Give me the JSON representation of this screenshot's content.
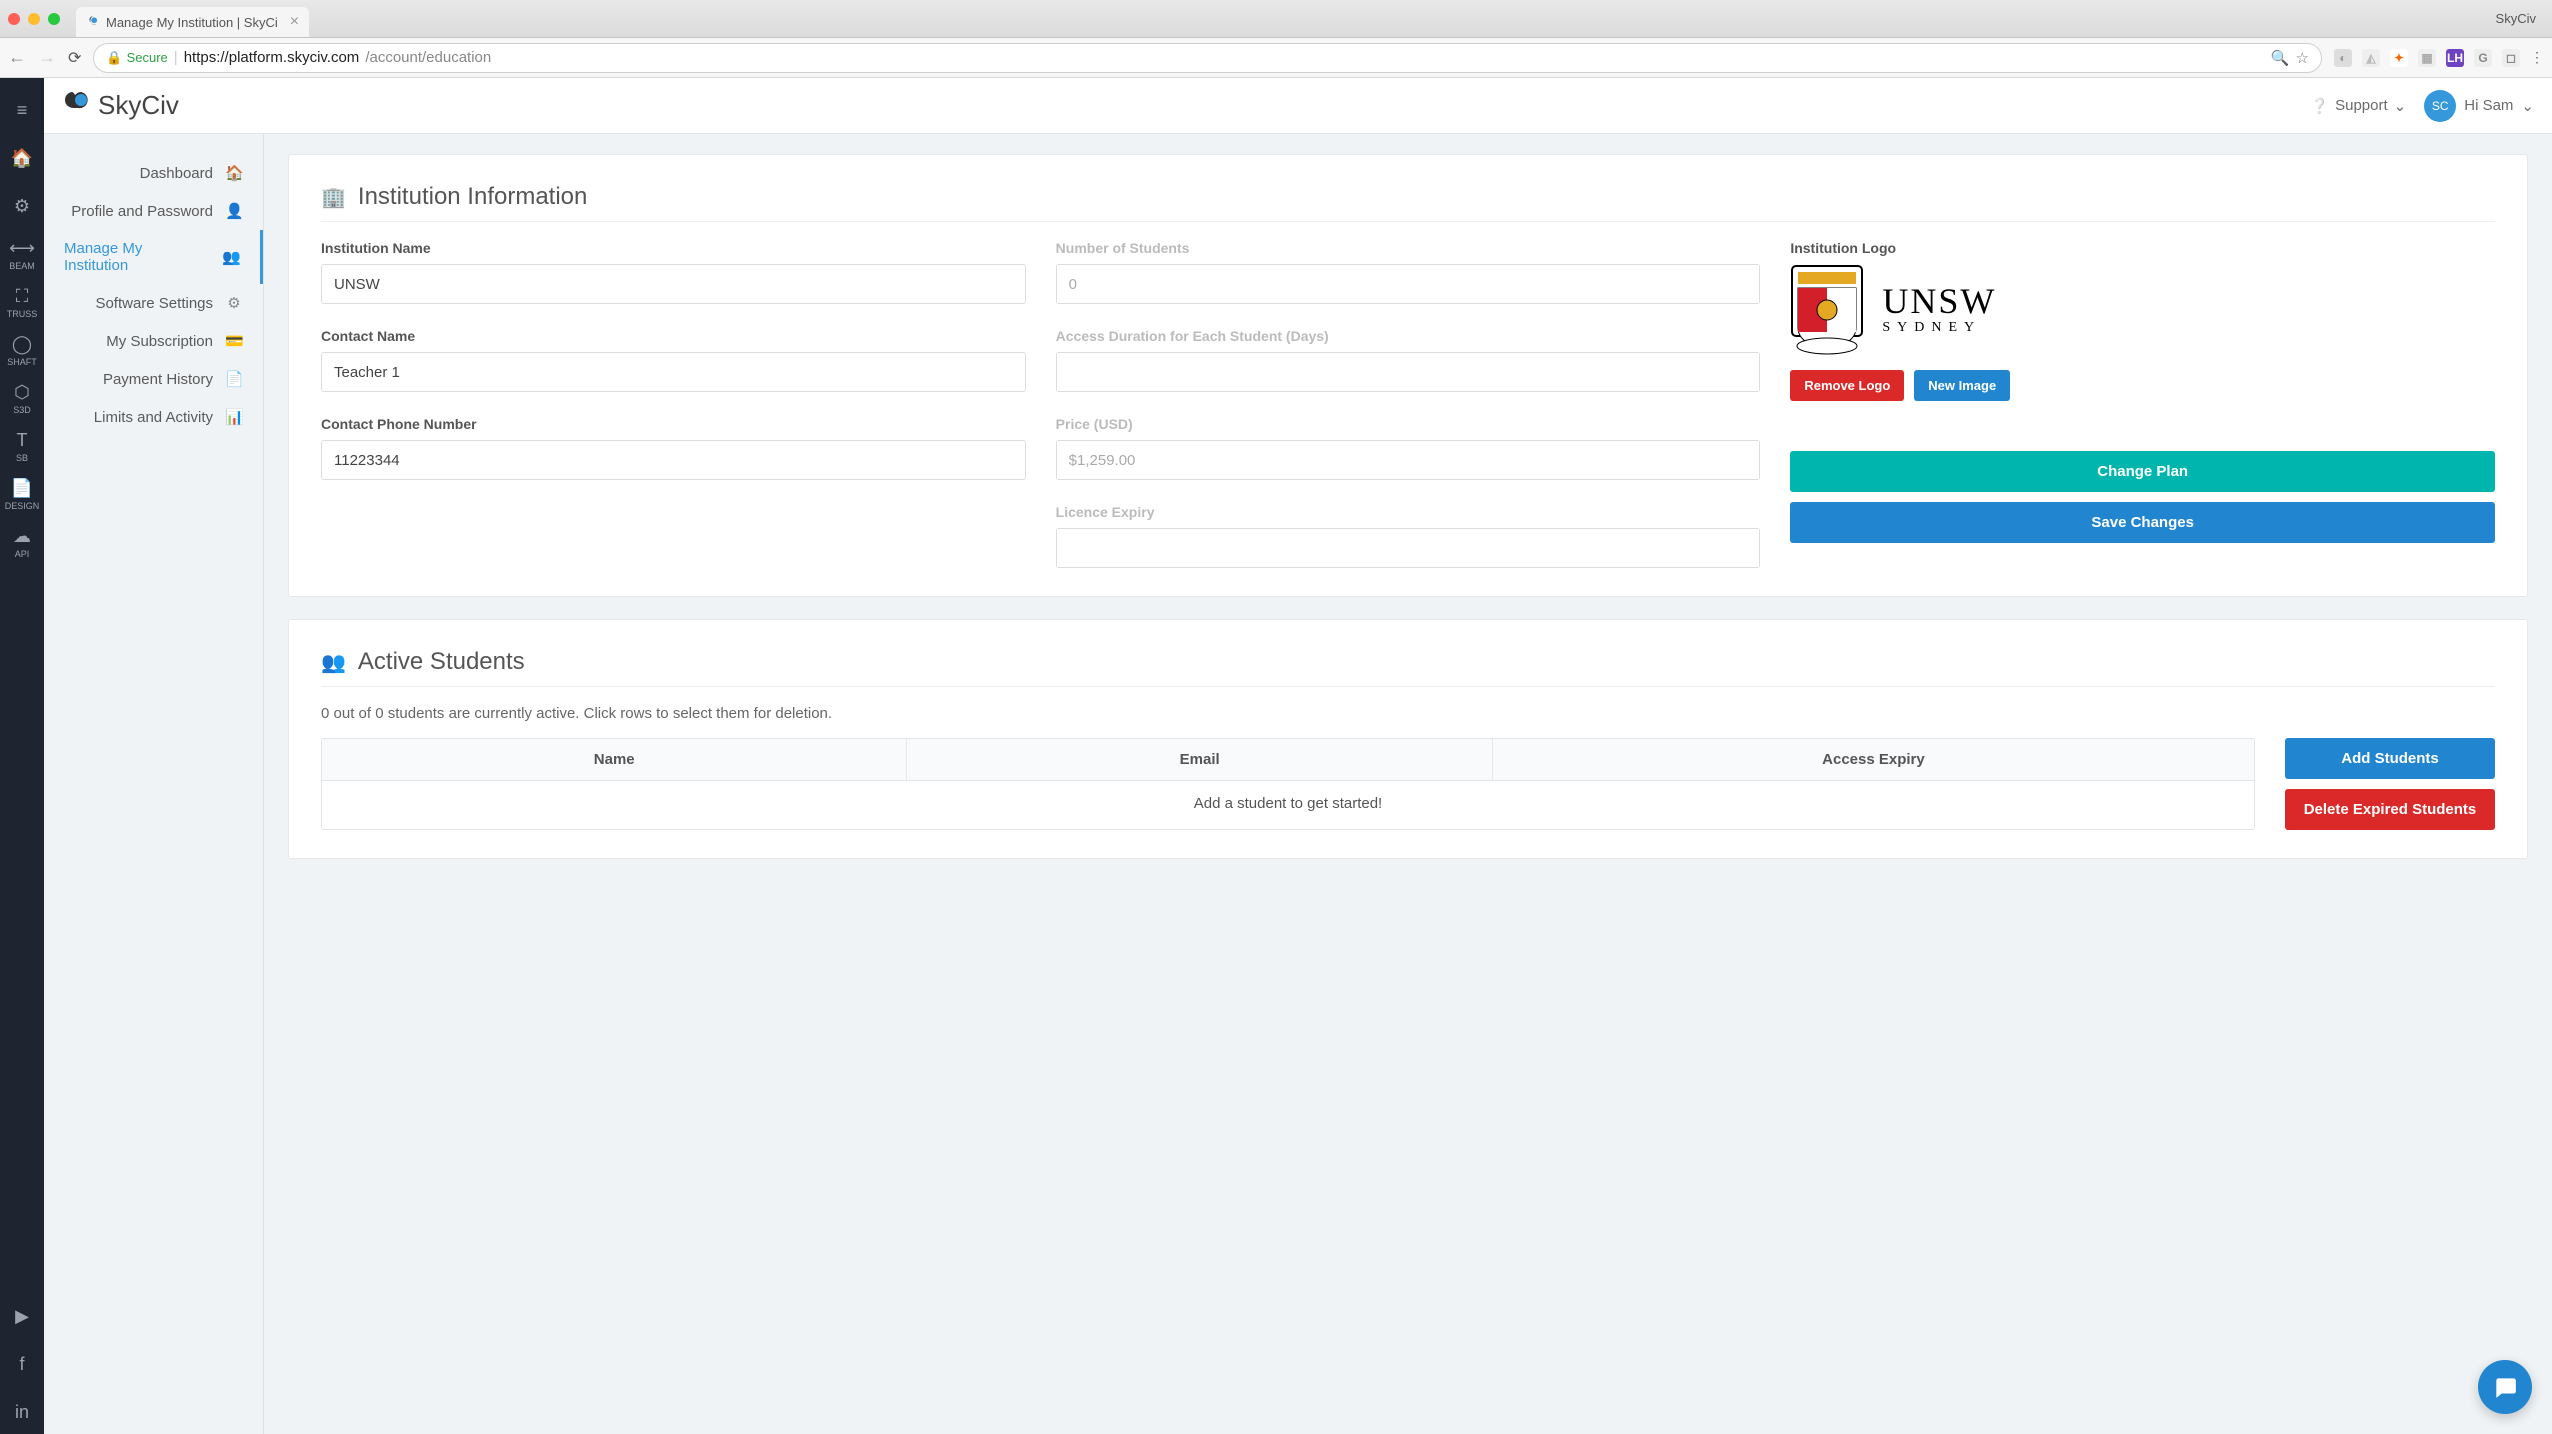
{
  "browser": {
    "tab_title": "Manage My Institution | SkyCi",
    "window_title": "SkyCiv",
    "secure_label": "Secure",
    "url_host": "https://platform.skyciv.com",
    "url_path": "/account/education"
  },
  "topbar": {
    "logo": "SkyCiv",
    "support": "Support",
    "avatar_initials": "SC",
    "greeting": "Hi Sam"
  },
  "leftbar": {
    "items": [
      {
        "label": "",
        "name": "home-icon"
      },
      {
        "label": "",
        "name": "gear-icon"
      },
      {
        "label": "BEAM",
        "name": "beam-icon"
      },
      {
        "label": "TRUSS",
        "name": "truss-icon"
      },
      {
        "label": "SHAFT",
        "name": "shaft-icon"
      },
      {
        "label": "S3D",
        "name": "s3d-icon"
      },
      {
        "label": "SB",
        "name": "sb-icon"
      },
      {
        "label": "DESIGN",
        "name": "design-icon"
      },
      {
        "label": "API",
        "name": "api-icon"
      }
    ],
    "social": [
      "youtube-icon",
      "facebook-icon",
      "linkedin-icon"
    ]
  },
  "sidebar": {
    "items": [
      {
        "label": "Dashboard",
        "icon": "home-icon"
      },
      {
        "label": "Profile and Password",
        "icon": "user-icon"
      },
      {
        "label": "Manage My Institution",
        "icon": "users-icon",
        "active": true
      },
      {
        "label": "Software Settings",
        "icon": "gear-icon"
      },
      {
        "label": "My Subscription",
        "icon": "card-icon"
      },
      {
        "label": "Payment History",
        "icon": "document-icon"
      },
      {
        "label": "Limits and Activity",
        "icon": "chart-icon"
      }
    ]
  },
  "institution": {
    "heading": "Institution Information",
    "name_label": "Institution Name",
    "name_value": "UNSW",
    "contact_label": "Contact Name",
    "contact_value": "Teacher 1",
    "phone_label": "Contact Phone Number",
    "phone_value": "11223344",
    "students_label": "Number of Students",
    "students_value": "0",
    "duration_label": "Access Duration for Each Student (Days)",
    "duration_value": "",
    "price_label": "Price (USD)",
    "price_value": "$1,259.00",
    "expiry_label": "Licence Expiry",
    "expiry_value": "",
    "logo_label": "Institution Logo",
    "logo_text_main": "UNSW",
    "logo_text_sub": "SYDNEY",
    "remove_logo": "Remove Logo",
    "new_image": "New Image",
    "change_plan": "Change Plan",
    "save": "Save Changes"
  },
  "students": {
    "heading": "Active Students",
    "desc": "0 out of 0 students are currently active. Click rows to select them for deletion.",
    "cols": {
      "c0": "Name",
      "c1": "Email",
      "c2": "Access Expiry"
    },
    "empty": "Add a student to get started!",
    "add": "Add Students",
    "delete": "Delete Expired Students"
  }
}
